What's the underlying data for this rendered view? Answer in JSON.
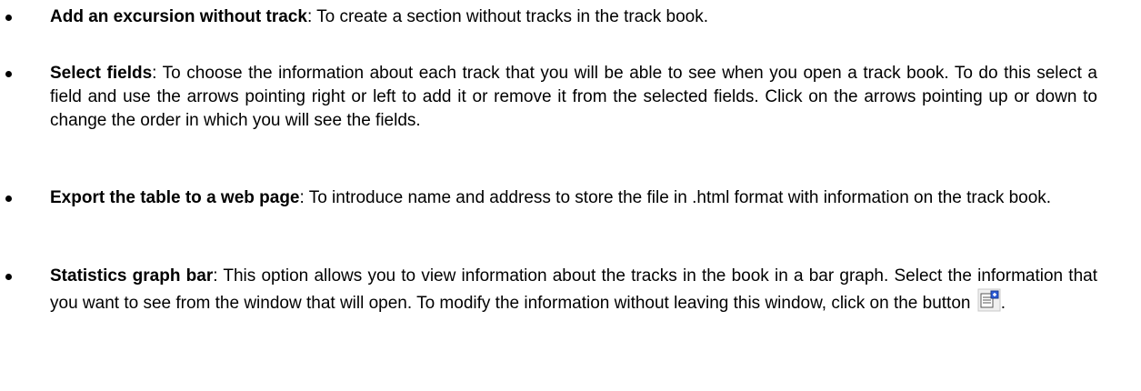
{
  "items": [
    {
      "term": "Add an excursion without track",
      "desc": ": To create a section without tracks in the track book."
    },
    {
      "term": "Select fields",
      "desc": ": To choose the information about each track that you will be able to see when you open a track book. To do this select a field and use the arrows pointing right or left to add it or remove it from the selected fields. Click on the arrows pointing up or down to change the order in which you will see the fields."
    },
    {
      "term": "Export the table to a web page",
      "desc": ": To introduce name and address to store the file in .html format with information on the track book."
    },
    {
      "term": "Statistics graph bar",
      "desc": ": This option allows you to view information about the tracks in the book in a bar graph. Select the information that you want to see from the window that will open. To modify the information without leaving this window, click on the button",
      "tail": "."
    }
  ],
  "icons": {
    "properties_button": "properties-icon"
  }
}
